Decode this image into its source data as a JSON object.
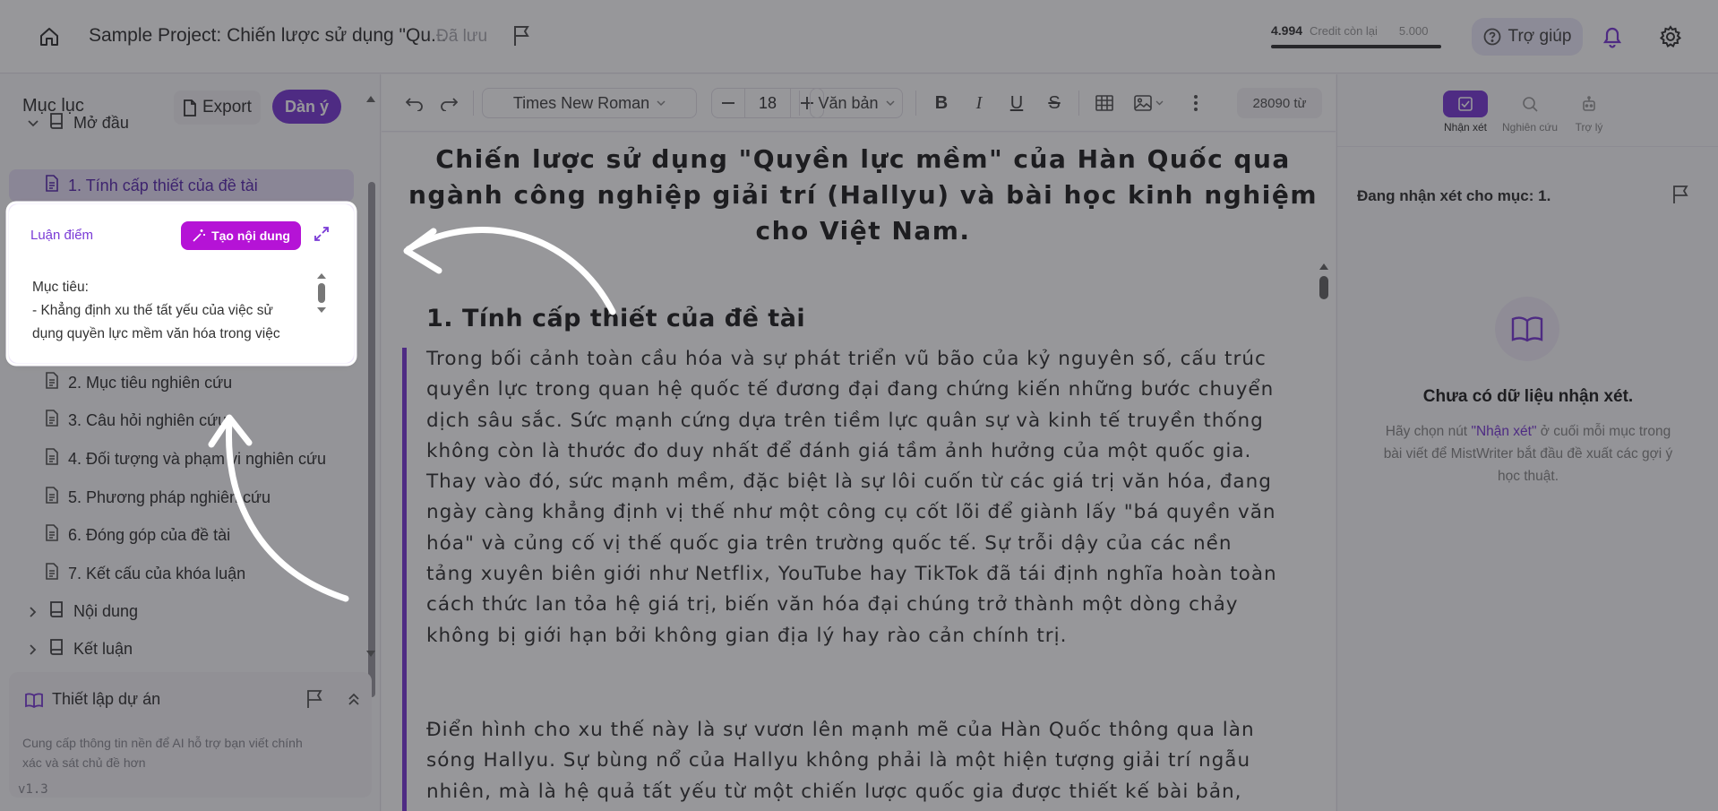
{
  "topbar": {
    "project_title": "Sample Project: Chiến lược sử dụng \"Qu...",
    "saved_status": "Đã lưu",
    "credit_remaining": "4.994",
    "credit_label": "Credit còn lại",
    "credit_total": "5.000",
    "credit_fraction": 0.9988,
    "help_label": "Trợ giúp"
  },
  "sidebar": {
    "title": "Mục lục",
    "export_label": "Export",
    "outline_label": "Dàn ý",
    "sections": [
      {
        "label": "Mở đầu"
      },
      {
        "label": "Nội dung"
      },
      {
        "label": "Kết luận"
      }
    ],
    "items": [
      {
        "label": "1. Tính cấp thiết của đề tài"
      },
      {
        "label": "2. Mục tiêu nghiên cứu"
      },
      {
        "label": "3. Câu hỏi nghiên cứu"
      },
      {
        "label": "4. Đối tượng và phạm vi nghiên cứu"
      },
      {
        "label": "5. Phương pháp nghiên cứu"
      },
      {
        "label": "6. Đóng góp của đề tài"
      },
      {
        "label": "7. Kết cấu của khóa luận"
      }
    ],
    "popup": {
      "title": "Luận điểm",
      "create_label": "Tạo nội dung",
      "line1": "Mục tiêu:",
      "line2": "- Khẳng định xu thế tất yếu của việc sử dụng quyền lực mềm văn hóa trong việc"
    },
    "setup": {
      "title": "Thiết lập dự án",
      "desc": "Cung cấp thông tin nền để AI hỗ trợ bạn viết chính xác và sát chủ đề hơn"
    },
    "version": "v1.3"
  },
  "toolbar": {
    "font": "Times New Roman",
    "size": "18",
    "style": "Văn bản",
    "word_count": "28090 từ"
  },
  "editor": {
    "title": "Chiến lược sử dụng \"Quyền lực mềm\" của Hàn Quốc qua ngành công nghiệp giải trí (Hallyu) và bài học kinh nghiệm cho Việt Nam.",
    "heading": "1. Tính cấp thiết của đề tài",
    "para1": "Trong bối cảnh toàn cầu hóa và sự phát triển vũ bão của kỷ nguyên số, cấu trúc quyền lực trong quan hệ quốc tế đương đại đang chứng kiến những bước chuyển dịch sâu sắc. Sức mạnh cứng dựa trên tiềm lực quân sự và kinh tế truyền thống không còn là thước đo duy nhất để đánh giá tầm ảnh hưởng của một quốc gia. Thay vào đó, sức mạnh mềm, đặc biệt là sự lôi cuốn từ các giá trị văn hóa, đang ngày càng khẳng định vị thế như một công cụ cốt lõi để giành lấy \"bá quyền văn hóa\" và củng cố vị thế quốc gia trên trường quốc tế. Sự trỗi dậy của các nền tảng xuyên biên giới như Netflix, YouTube hay TikTok đã tái định nghĩa hoàn toàn cách thức lan tỏa hệ giá trị, biến văn hóa đại chúng trở thành một dòng chảy không bị giới hạn bởi không gian địa lý hay rào cản chính trị.",
    "para2": "Điển hình cho xu thế này là sự vươn lên mạnh mẽ của Hàn Quốc thông qua làn sóng Hallyu. Sự bùng nổ của Hallyu không phải là một hiện tượng giải trí ngẫu nhiên, mà là hệ quả tất yếu từ một chiến lược quốc gia được thiết kế bài bản,"
  },
  "rpanel": {
    "tabs": [
      {
        "label": "Nhận xét"
      },
      {
        "label": "Nghiên cứu"
      },
      {
        "label": "Trợ lý"
      }
    ],
    "review_for": "Đang nhận xét cho mục: 1.",
    "empty_title": "Chưa có dữ liệu nhận xét.",
    "empty_desc_pre": "Hãy chọn nút ",
    "empty_desc_hl": "\"Nhận xét\"",
    "empty_desc_post": " ở cuối mỗi mục trong bài viết để MistWriter bắt đầu đề xuất các gợi ý học thuật."
  },
  "colors": {
    "accent": "#7a3bd6",
    "create_button": "#b513d6"
  }
}
